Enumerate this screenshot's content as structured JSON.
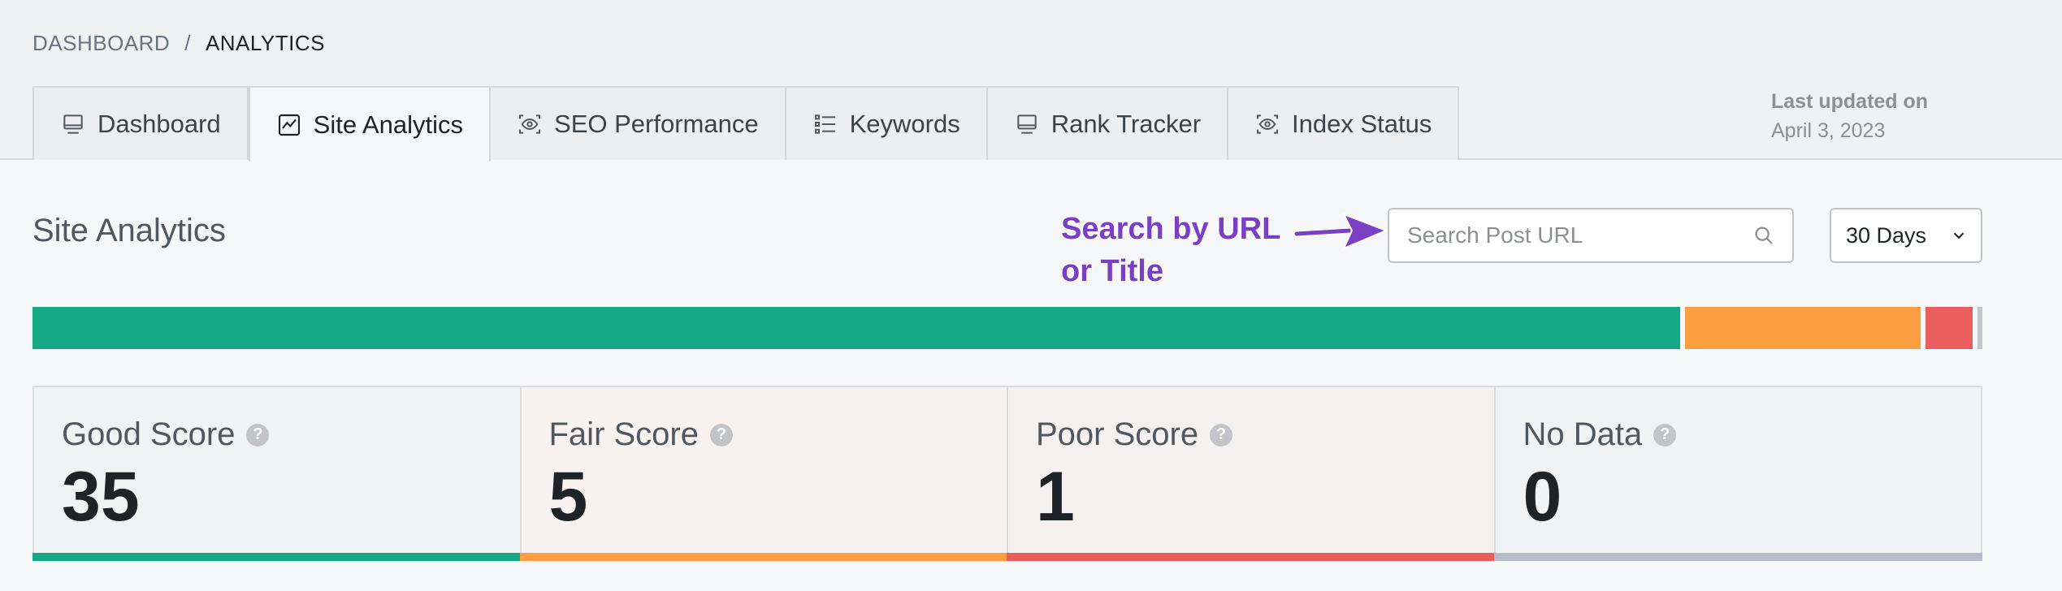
{
  "breadcrumb": {
    "parent": "DASHBOARD",
    "separator": "/",
    "current": "ANALYTICS"
  },
  "tabs": [
    {
      "label": "Dashboard",
      "icon": "monitor-icon",
      "active": false
    },
    {
      "label": "Site Analytics",
      "icon": "chart-icon",
      "active": true
    },
    {
      "label": "SEO Performance",
      "icon": "eye-icon",
      "active": false
    },
    {
      "label": "Keywords",
      "icon": "list-icon",
      "active": false
    },
    {
      "label": "Rank Tracker",
      "icon": "monitor-icon",
      "active": false
    },
    {
      "label": "Index Status",
      "icon": "eye-icon",
      "active": false
    }
  ],
  "last_updated": {
    "label": "Last updated on",
    "date": "April 3, 2023"
  },
  "section": {
    "title": "Site Analytics"
  },
  "annotation": {
    "text": "Search by URL\nor Title",
    "color": "#7b3fc4"
  },
  "search": {
    "placeholder": "Search Post URL",
    "value": ""
  },
  "range_select": {
    "value": "30 Days"
  },
  "score_bar": [
    {
      "name": "good",
      "value": 35,
      "color": "#14a884"
    },
    {
      "name": "fair",
      "value": 5,
      "color": "#fd9f41"
    },
    {
      "name": "poor",
      "value": 1,
      "color": "#ea5d5d"
    },
    {
      "name": "no-data",
      "value": 0,
      "color": "#c3c6cd"
    }
  ],
  "cards": [
    {
      "label": "Good Score",
      "value": "35",
      "bg": "#eef4f4",
      "accent": "#14a884"
    },
    {
      "label": "Fair Score",
      "value": "5",
      "bg": "#f8f3f1",
      "accent": "#fd9f41"
    },
    {
      "label": "Poor Score",
      "value": "1",
      "bg": "#f6f1f1",
      "accent": "#ea5d5d"
    },
    {
      "label": "No Data",
      "value": "0",
      "bg": "#f1f2f4",
      "accent": "#b7bcc7"
    }
  ]
}
